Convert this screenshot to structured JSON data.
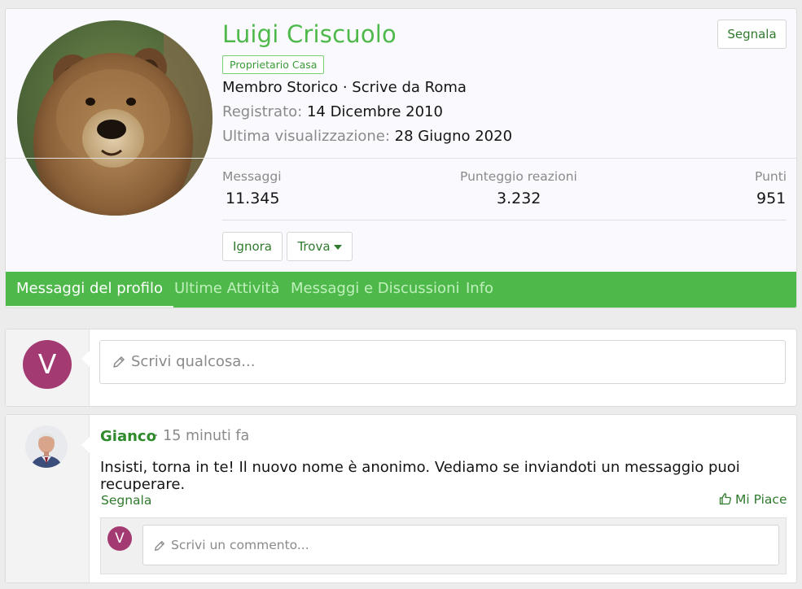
{
  "profile": {
    "name": "Luigi Criscuolo",
    "role_badge": "Proprietario Casa",
    "member_line": "Membro Storico · Scrive da Roma",
    "registered_label": "Registrato:",
    "registered_value": "14 Dicembre 2010",
    "last_seen_label": "Ultima visualizzazione:",
    "last_seen_value": "28 Giugno 2020",
    "report_label": "Segnala",
    "stats": [
      {
        "label": "Messaggi",
        "value": "11.345"
      },
      {
        "label": "Punteggio reazioni",
        "value": "3.232"
      },
      {
        "label": "Punti",
        "value": "951"
      }
    ],
    "ignore_label": "Ignora",
    "find_label": "Trova",
    "avatar_icon": "bear-photo"
  },
  "tabs": [
    {
      "label": "Messaggi del profilo",
      "active": true
    },
    {
      "label": "Ultime Attività",
      "active": false
    },
    {
      "label": "Messaggi e Discussioni",
      "active": false
    },
    {
      "label": "Info",
      "active": false
    }
  ],
  "composer": {
    "avatar_letter": "V",
    "placeholder": "Scrivi qualcosa..."
  },
  "post": {
    "author": "Gianco",
    "time": "· 15 minuti fa",
    "body": "Insisti, torna in te! Il nuovo nome è anonimo. Vediamo se inviandoti un messaggio puoi recuperare.",
    "report_label": "Segnala",
    "like_label": "Mi Piace",
    "comment_avatar_letter": "V",
    "comment_placeholder": "Scrivi un commento..."
  },
  "colors": {
    "accent": "#4eb94a",
    "link": "#2f7a2d",
    "avatar_v": "#a43a72"
  }
}
